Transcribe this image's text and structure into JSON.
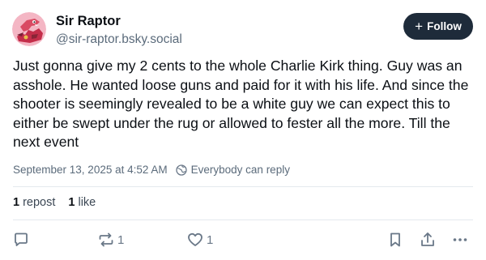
{
  "author": {
    "display_name": "Sir Raptor",
    "handle": "@sir-raptor.bsky.social",
    "avatar_icon": "raptor-avatar-icon"
  },
  "follow_button": {
    "label": "Follow",
    "icon": "plus-icon"
  },
  "post": {
    "text": "Just gonna give my 2 cents to the whole Charlie Kirk thing. Guy was an asshole. He wanted loose guns and paid for it with his life. And since the shooter is seemingly revealed to be a white guy we can expect this to either be swept under the rug or allowed to fester all the more. Till the next event",
    "timestamp": "September 13, 2025 at 4:52 AM",
    "reply_setting": "Everybody can reply"
  },
  "stats": {
    "reposts_count": "1",
    "reposts_label": "repost",
    "likes_count": "1",
    "likes_label": "like"
  },
  "actions": {
    "reply_icon": "comment-icon",
    "repost_icon": "repost-icon",
    "repost_count": "1",
    "like_icon": "heart-icon",
    "like_count": "1",
    "bookmark_icon": "bookmark-icon",
    "share_icon": "share-icon",
    "more_icon": "more-icon"
  },
  "colors": {
    "follow_bg": "#1e2b3a",
    "secondary_text": "#5b6b7b",
    "icon_gray": "#6a7888",
    "divider": "#e4e9ee",
    "avatar_pink": "#f2a7b8"
  }
}
